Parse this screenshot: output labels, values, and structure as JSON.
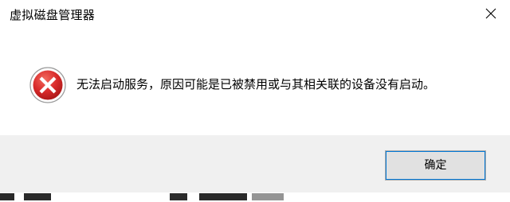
{
  "dialog": {
    "title": "虚拟磁盘管理器",
    "message": "无法启动服务，原因可能是已被禁用或与其相关联的设备没有启动。",
    "icon": "error-icon",
    "ok_label": "确定"
  },
  "colors": {
    "error_red": "#d92b2b",
    "button_bar": "#f0f0f0",
    "focus_border": "#0078d7"
  }
}
